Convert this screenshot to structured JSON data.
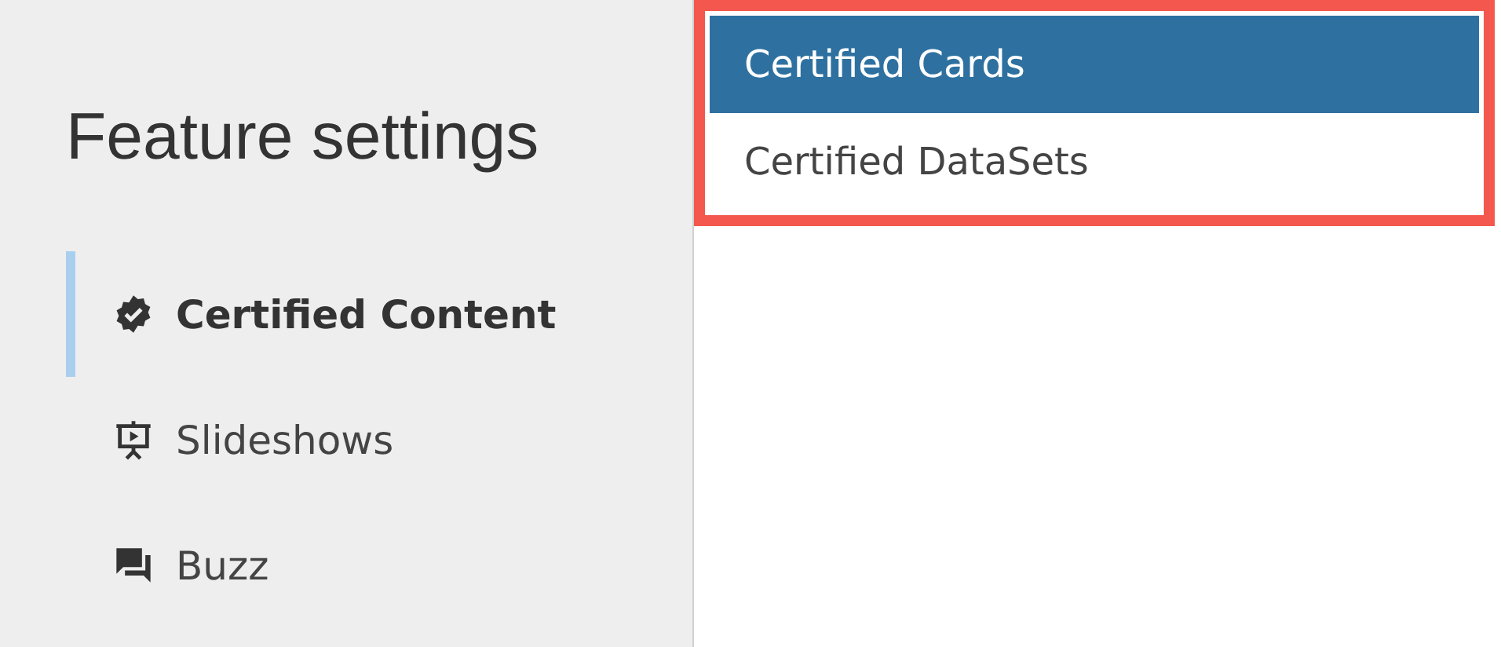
{
  "sidebar": {
    "title": "Feature settings",
    "items": [
      {
        "label": "Certified Content",
        "kind": "certified",
        "selected": true
      },
      {
        "label": "Slideshows",
        "kind": "slideshow",
        "selected": false
      },
      {
        "label": "Buzz",
        "kind": "chat",
        "selected": false
      }
    ]
  },
  "submenu": {
    "items": [
      {
        "label": "Certified Cards",
        "selected": true
      },
      {
        "label": "Certified DataSets",
        "selected": false
      }
    ]
  }
}
